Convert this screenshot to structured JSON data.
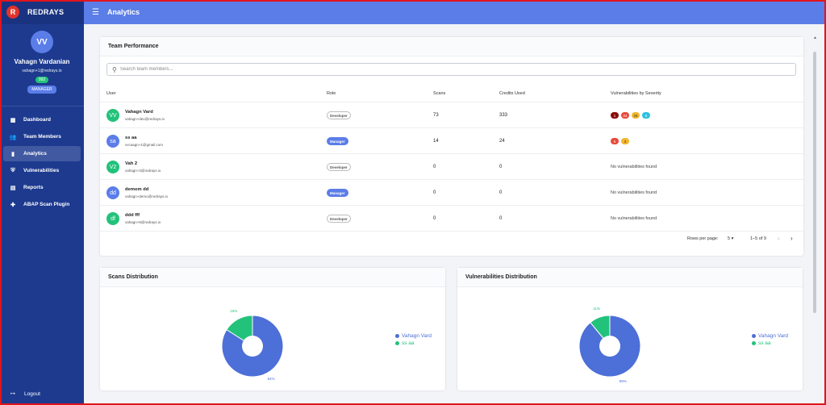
{
  "brand": {
    "logo_letter": "R",
    "name": "REDRAYS"
  },
  "profile": {
    "initials": "VV",
    "name": "Vahagn Vardanian",
    "email": "vahagn+1@redrays.io",
    "credits": "992",
    "role": "MANAGER"
  },
  "nav": [
    {
      "label": "Dashboard",
      "icon": "dashboard-icon",
      "glyph": "▦",
      "active": false
    },
    {
      "label": "Team Members",
      "icon": "team-icon",
      "glyph": "👥",
      "active": false
    },
    {
      "label": "Analytics",
      "icon": "analytics-icon",
      "glyph": "▮",
      "active": true
    },
    {
      "label": "Vulnerabilities",
      "icon": "shield-icon",
      "glyph": "⛨",
      "active": false
    },
    {
      "label": "Reports",
      "icon": "report-icon",
      "glyph": "▤",
      "active": false
    },
    {
      "label": "ABAP Scan Plugin",
      "icon": "plugin-icon",
      "glyph": "✚",
      "active": false
    }
  ],
  "logout": {
    "label": "Logout"
  },
  "topbar": {
    "title": "Analytics"
  },
  "team": {
    "title": "Team Performance",
    "search_placeholder": "Search team members...",
    "columns": [
      "User",
      "Role",
      "Scans",
      "Credits Used",
      "Vulnerabilities by Severity"
    ],
    "rows": [
      {
        "initials": "VV",
        "avatar_color": "#22c27a",
        "name": "Vahagn Vard",
        "email": "vahagn+dev@redrays.io",
        "role": "Developer",
        "role_type": "dev",
        "scans": "73",
        "credits": "333",
        "severity": [
          {
            "v": "1",
            "bg": "#8b0d0d",
            "fg": "#fff"
          },
          {
            "v": "24",
            "bg": "#e84a3b",
            "fg": "#fff"
          },
          {
            "v": "25",
            "bg": "#f3b62d",
            "fg": "#333"
          },
          {
            "v": "5",
            "bg": "#2ec1e0",
            "fg": "#fff"
          }
        ],
        "no_vulns": ""
      },
      {
        "initials": "sa",
        "avatar_color": "#5b7de8",
        "name": "ss aa",
        "email": "vvcaagn+1@gmail.com",
        "role": "Manager",
        "role_type": "mgr",
        "scans": "14",
        "credits": "24",
        "severity": [
          {
            "v": "5",
            "bg": "#e84a3b",
            "fg": "#fff"
          },
          {
            "v": "3",
            "bg": "#f3b62d",
            "fg": "#333"
          }
        ],
        "no_vulns": ""
      },
      {
        "initials": "V2",
        "avatar_color": "#22c27a",
        "name": "Vah 2",
        "email": "vahagn+3@redrays.io",
        "role": "Developer",
        "role_type": "dev",
        "scans": "0",
        "credits": "0",
        "severity": [],
        "no_vulns": "No vulnerabilities found"
      },
      {
        "initials": "dd",
        "avatar_color": "#5b7de8",
        "name": "demom dd",
        "email": "vahagn+demo@redrays.io",
        "role": "Manager",
        "role_type": "mgr",
        "scans": "0",
        "credits": "0",
        "severity": [],
        "no_vulns": "No vulnerabilities found"
      },
      {
        "initials": "df",
        "avatar_color": "#22c27a",
        "name": "ddd fff",
        "email": "vahagn+8@redrays.io",
        "role": "Developer",
        "role_type": "dev",
        "scans": "0",
        "credits": "0",
        "severity": [],
        "no_vulns": "No vulnerabilities found"
      }
    ],
    "pagination": {
      "rows_per_page_label": "Rows per page:",
      "rows_per_page": "5",
      "range": "1–5 of 9"
    }
  },
  "chart_data": [
    {
      "type": "pie",
      "title": "Scans Distribution",
      "labels": [
        "Vahagn Vard",
        "ss aa"
      ],
      "values": [
        84,
        16
      ],
      "data_labels": [
        "84%",
        "16%"
      ],
      "colors": [
        "#4c6fd8",
        "#22c27a"
      ],
      "legend_position": "right"
    },
    {
      "type": "pie",
      "title": "Vulnerabilities Distribution",
      "labels": [
        "Vahagn Vard",
        "ss aa"
      ],
      "values": [
        89,
        11
      ],
      "data_labels": [
        "89%",
        "11%"
      ],
      "colors": [
        "#4c6fd8",
        "#22c27a"
      ],
      "legend_position": "right"
    }
  ]
}
